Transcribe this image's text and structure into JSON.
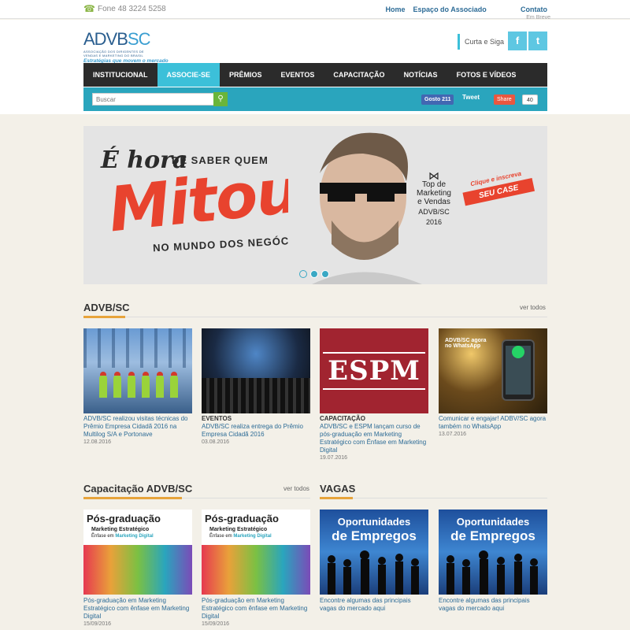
{
  "topbar": {
    "phone": "Fone 48 3224 5258",
    "links": [
      "Home",
      "Espaço do Associado",
      "Contato"
    ],
    "em_breve": "Em Breve"
  },
  "header": {
    "logo_main_a": "ADVB",
    "logo_main_b": "SC",
    "logo_sub1": "ASSOCIAÇÃO DOS DIRIGENTES DE",
    "logo_sub2": "VENDAS E MARKETING DO BRASIL",
    "logo_tag": "Estratégias que movem o mercado",
    "curta": "Curta e Siga",
    "facebook": "f",
    "twitter": "t"
  },
  "nav": {
    "items": [
      "INSTITUCIONAL",
      "ASSOCIE-SE",
      "PRÊMIOS",
      "EVENTOS",
      "CAPACITAÇÃO",
      "NOTÍCIAS",
      "FOTOS E VÍDEOS"
    ],
    "active_index": 1
  },
  "subbar": {
    "search_placeholder": "Buscar",
    "like": "Gosto 211",
    "tweet": "Tweet",
    "share": "Share",
    "share_count": "40"
  },
  "banner": {
    "hora": "É hora",
    "de_saber": "DE SABER QUEM",
    "mitou": "Mitou",
    "mundo": "NO MUNDO DOS NEGÓCIOS.",
    "top1": "Top de",
    "top2": "Marketing",
    "top3": "e Vendas",
    "top4": "ADVB/SC",
    "top5": "2016",
    "cta_small": "Clique e inscreva",
    "cta_big": "SEU CASE",
    "slides": 3
  },
  "advb": {
    "title": "ADVB/SC",
    "ver_todos": "ver todos",
    "cards": [
      {
        "category": "",
        "title": "ADVB/SC realizou visitas técnicas do Prêmio Empresa Cidadã 2016 na Multilog S/A e Portonave",
        "date": "12.08.2016"
      },
      {
        "category": "EVENTOS",
        "title": "ADVB/SC realiza entrega do Prêmio Empresa Cidadã 2016",
        "date": "03.08.2016"
      },
      {
        "category": "CAPACITAÇÃO",
        "title": "ADVB/SC e ESPM lançam curso de pós-graduação em Marketing Estratégico com Ênfase em Marketing Digital",
        "date": "19.07.2016"
      },
      {
        "category": "",
        "title": "Comunicar e engajar! ADBV/SC agora também no WhatsApp",
        "date": "13.07.2016"
      }
    ],
    "espm_text": "ESPM",
    "whats_text": "ADVB/SC agora no WhatsApp"
  },
  "capacitacao": {
    "title": "Capacitação ADVB/SC",
    "ver_todos": "ver todos",
    "img_title": "Pós-graduação",
    "img_sub": "Marketing Estratégico",
    "img_sub2_a": "Ênfase em ",
    "img_sub2_b": "Marketing Digital",
    "cards": [
      {
        "title": "Pós-graduação em Marketing Estratégico com ênfase em Marketing Digital",
        "date": "15/09/2016"
      },
      {
        "title": "Pós-graduação em Marketing Estratégico com ênfase em Marketing Digital",
        "date": "15/09/2016"
      }
    ]
  },
  "vagas": {
    "title": "VAGAS",
    "img_line1": "Oportunidades",
    "img_line2": "de Empregos",
    "cards": [
      {
        "title": "Encontre algumas das principais vagas do mercado aqui"
      },
      {
        "title": "Encontre algumas das principais vagas do mercado aqui"
      }
    ]
  }
}
